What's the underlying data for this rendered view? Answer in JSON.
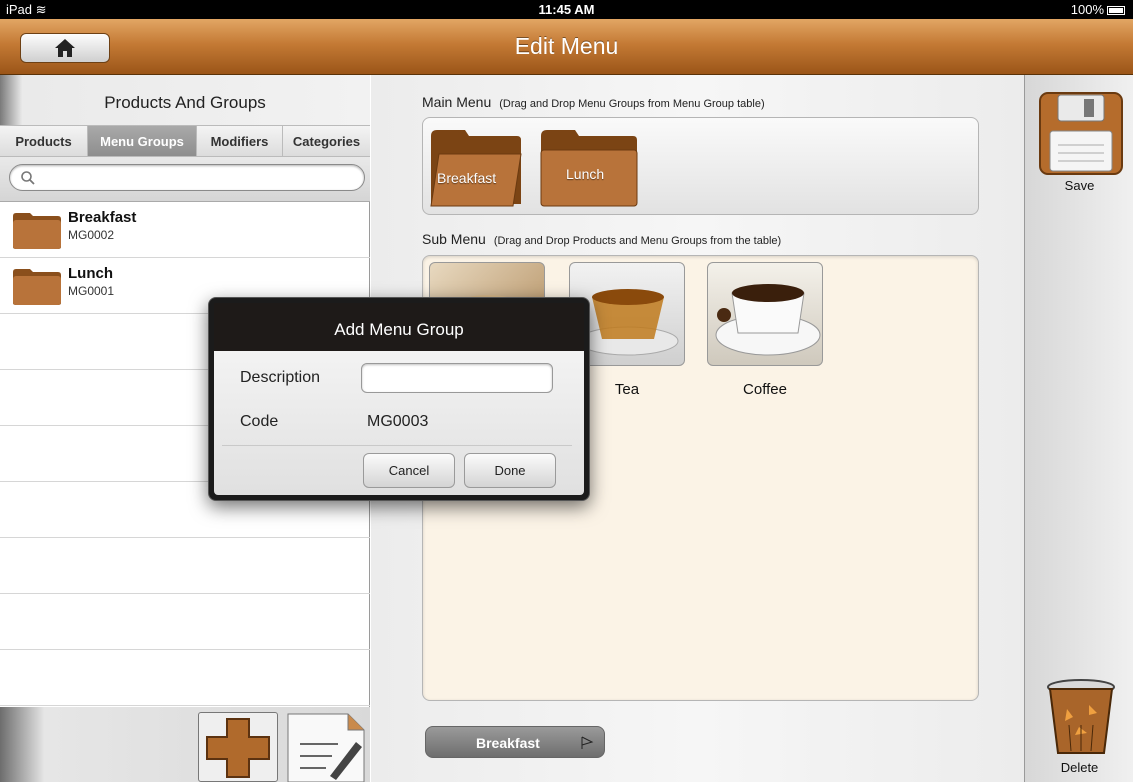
{
  "status_bar": {
    "device": "iPad",
    "time": "11:45 AM",
    "battery": "100%"
  },
  "nav": {
    "title": "Edit Menu",
    "home_icon": "home-icon"
  },
  "left_panel": {
    "header": "Products And Groups",
    "tabs": [
      {
        "label": "Products",
        "active": false
      },
      {
        "label": "Menu Groups",
        "active": true
      },
      {
        "label": "Modifiers",
        "active": false
      },
      {
        "label": "Categories",
        "active": false
      }
    ],
    "search": {
      "placeholder": ""
    },
    "items": [
      {
        "name": "Breakfast",
        "code": "MG0002"
      },
      {
        "name": "Lunch",
        "code": "MG0001"
      }
    ]
  },
  "center": {
    "main_menu_label": "Main Menu",
    "main_menu_hint": "(Drag and Drop Menu Groups from Menu Group table)",
    "main_menu_items": [
      "Breakfast",
      "Lunch"
    ],
    "sub_menu_label": "Sub Menu",
    "sub_menu_hint": "(Drag and Drop Products and Menu Groups from the table)",
    "sub_menu_items": [
      "",
      "Tea",
      "Coffee"
    ],
    "bottom_tab": "Breakfast"
  },
  "right_panel": {
    "save_label": "Save",
    "delete_label": "Delete"
  },
  "modal": {
    "title": "Add Menu Group",
    "description_label": "Description",
    "description_value": "",
    "code_label": "Code",
    "code_value": "MG0003",
    "cancel_label": "Cancel",
    "done_label": "Done"
  },
  "colors": {
    "accent_brown": "#c47a35",
    "folder_brown": "#a9652a",
    "sub_menu_bg": "#fbf3e6"
  }
}
